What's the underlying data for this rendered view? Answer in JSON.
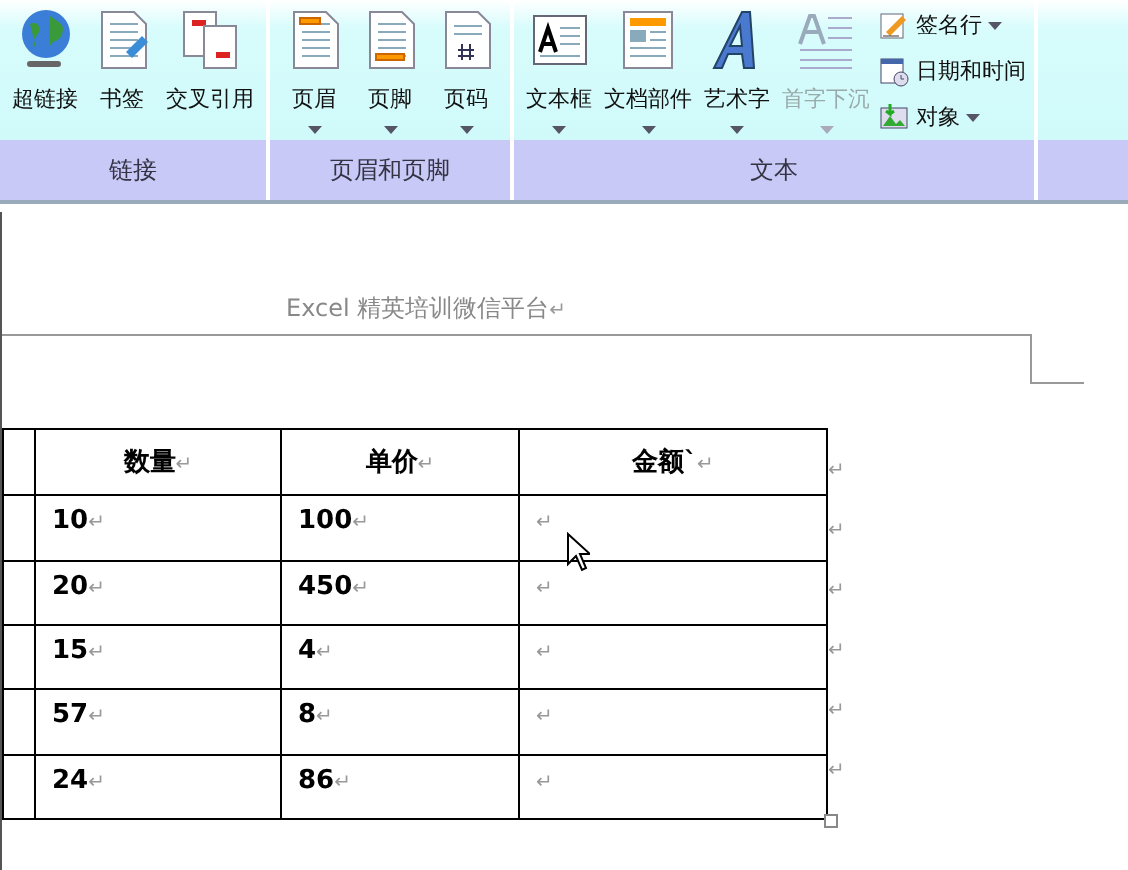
{
  "ribbon": {
    "groups": [
      {
        "label": "链接",
        "buttons": [
          {
            "label": "超链接",
            "has_menu": false,
            "disabled": false
          },
          {
            "label": "书签",
            "has_menu": false,
            "disabled": false
          },
          {
            "label": "交叉引用",
            "has_menu": false,
            "disabled": false
          }
        ]
      },
      {
        "label": "页眉和页脚",
        "buttons": [
          {
            "label": "页眉",
            "has_menu": true,
            "disabled": false
          },
          {
            "label": "页脚",
            "has_menu": true,
            "disabled": false
          },
          {
            "label": "页码",
            "has_menu": true,
            "disabled": false
          }
        ]
      },
      {
        "label": "文本",
        "buttons": [
          {
            "label": "文本框",
            "has_menu": true,
            "disabled": false
          },
          {
            "label": "文档部件",
            "has_menu": true,
            "disabled": false
          },
          {
            "label": "艺术字",
            "has_menu": true,
            "disabled": false
          },
          {
            "label": "首字下沉",
            "has_menu": true,
            "disabled": true
          }
        ],
        "small_buttons": [
          {
            "label": "签名行",
            "has_menu": true
          },
          {
            "label": "日期和时间",
            "has_menu": false
          },
          {
            "label": "对象",
            "has_menu": true
          }
        ]
      }
    ]
  },
  "document": {
    "header_text": "Excel 精英培训微信平台",
    "header_mark": "↵",
    "table": {
      "columns": [
        {
          "label": "数量",
          "mark": "↵"
        },
        {
          "label": "单价",
          "mark": "↵"
        },
        {
          "label": "金额`",
          "mark": "↵"
        }
      ],
      "header_row_mark": "↵",
      "rows": [
        {
          "cells": [
            {
              "text": "10",
              "mark": "↵"
            },
            {
              "text": "100",
              "mark": "↵"
            },
            {
              "mark": "↵"
            }
          ],
          "row_mark": "↵"
        },
        {
          "cells": [
            {
              "text": "20",
              "mark": "↵"
            },
            {
              "text": "450",
              "mark": "↵"
            },
            {
              "mark": "↵"
            }
          ],
          "row_mark": "↵"
        },
        {
          "cells": [
            {
              "text": "15",
              "mark": "↵"
            },
            {
              "text": "4",
              "mark": "↵"
            },
            {
              "mark": "↵"
            }
          ],
          "row_mark": "↵"
        },
        {
          "cells": [
            {
              "text": "57",
              "mark": "↵"
            },
            {
              "text": "8",
              "mark": "↵"
            },
            {
              "mark": "↵"
            }
          ],
          "row_mark": "↵"
        },
        {
          "cells": [
            {
              "text": "24",
              "mark": "↵"
            },
            {
              "text": "86",
              "mark": "↵"
            },
            {
              "mark": "↵"
            }
          ],
          "row_mark": "↵"
        }
      ]
    }
  }
}
